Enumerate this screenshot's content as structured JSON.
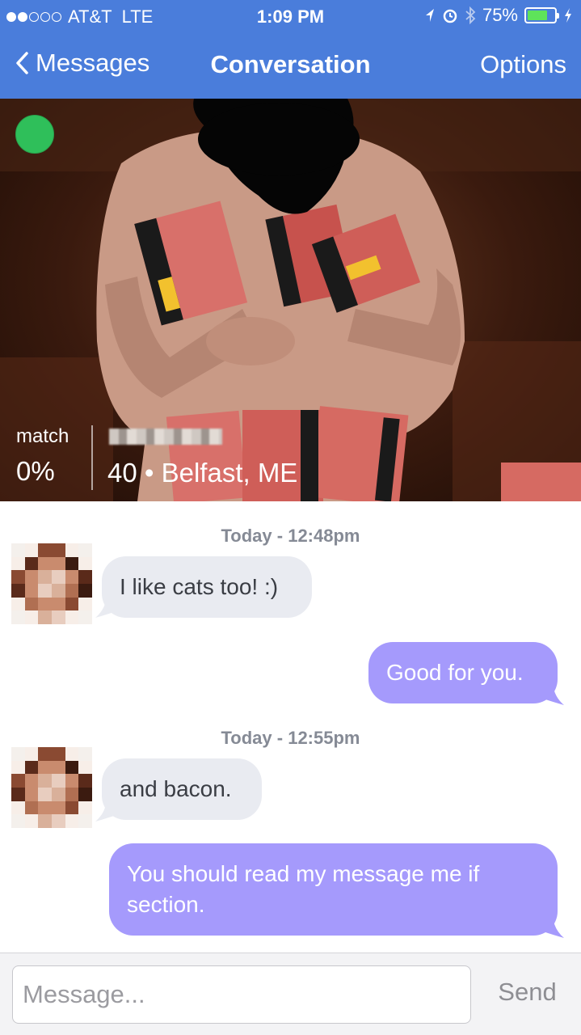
{
  "status_bar": {
    "carrier": "AT&T",
    "network": "LTE",
    "time": "1:09 PM",
    "battery": "75%",
    "battery_level": 0.75,
    "signal_bars": 2
  },
  "nav": {
    "back_label": "Messages",
    "title": "Conversation",
    "options_label": "Options"
  },
  "profile": {
    "online": true,
    "match_label": "match",
    "match_value": "0%",
    "age_location": "40 • Belfast, ME"
  },
  "messages": [
    {
      "timestamp": "Today - 12:48pm"
    },
    {
      "direction": "incoming",
      "text": "I like cats too! :)"
    },
    {
      "direction": "outgoing",
      "text": "Good for you."
    },
    {
      "timestamp": "Today - 12:55pm"
    },
    {
      "direction": "incoming",
      "text": "and bacon."
    },
    {
      "direction": "outgoing",
      "text": "You should read my message me if section."
    }
  ],
  "composer": {
    "placeholder": "Message...",
    "send_label": "Send"
  },
  "colors": {
    "header": "#4a7ddb",
    "incoming_bubble": "#e9ebf1",
    "outgoing_bubble": "#a59afc",
    "online": "#2fbf5a"
  }
}
